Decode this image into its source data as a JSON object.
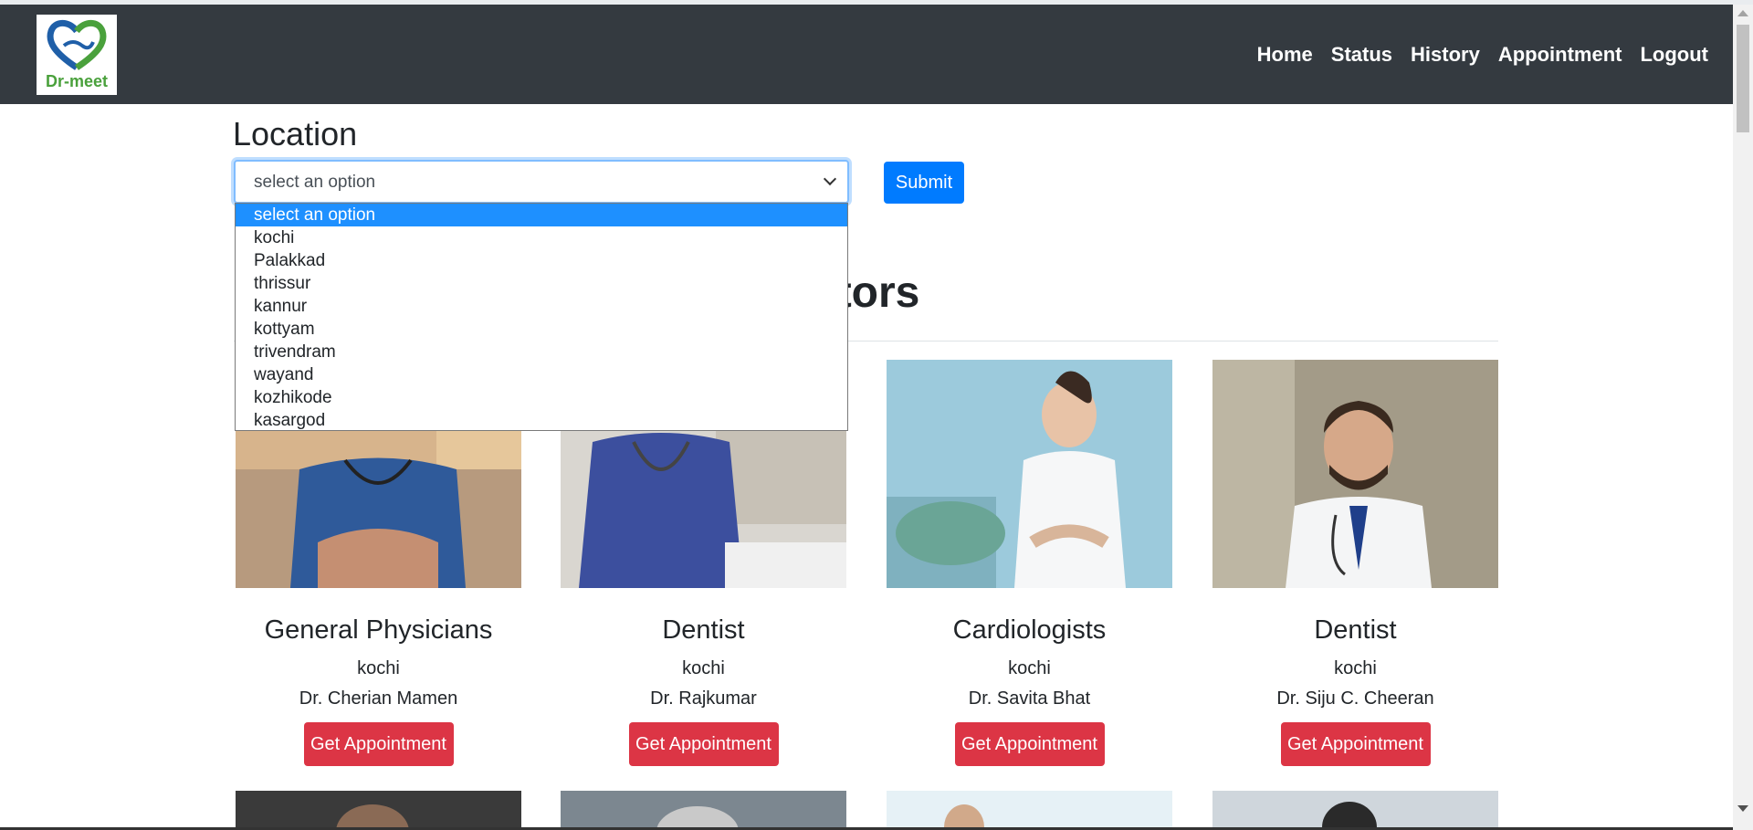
{
  "logo": {
    "text": "Dr-meet"
  },
  "nav": {
    "items": [
      "Home",
      "Status",
      "History",
      "Appointment",
      "Logout"
    ]
  },
  "search": {
    "label": "Location",
    "selected_value": "select an option",
    "options": [
      "select an option",
      "kochi",
      "Palakkad",
      "thrissur",
      "kannur",
      "kottyam",
      "trivendram",
      "wayand",
      "kozhikode",
      "kasargod"
    ],
    "submit_label": "Submit"
  },
  "section": {
    "title_visible": "ctors"
  },
  "doctors": [
    {
      "specialty": "General Physicians",
      "city": "kochi",
      "name": "Dr. Cherian Mamen",
      "button": "Get Appointment"
    },
    {
      "specialty": "Dentist",
      "city": "kochi",
      "name": "Dr. Rajkumar",
      "button": "Get Appointment"
    },
    {
      "specialty": "Cardiologists",
      "city": "kochi",
      "name": "Dr. Savita Bhat",
      "button": "Get Appointment"
    },
    {
      "specialty": "Dentist",
      "city": "kochi",
      "name": "Dr. Siju C. Cheeran",
      "button": "Get Appointment"
    }
  ],
  "colors": {
    "navbar": "#343a40",
    "primary": "#007bff",
    "danger": "#dc3545",
    "selected_option": "#1e90ff",
    "logo_green": "#4aa13c"
  }
}
